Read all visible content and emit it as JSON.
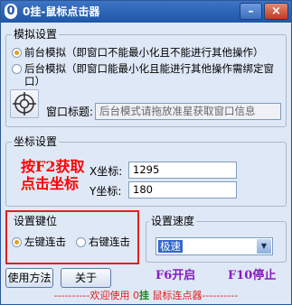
{
  "window": {
    "logo_glyph": "0",
    "title": "0挂-鼠标点击器",
    "minimize_glyph": "–",
    "close_glyph": "×"
  },
  "mode_group": {
    "label": "模拟设置",
    "options": [
      {
        "label": "前台模拟（即窗口不能最小化且不能进行其他操作）",
        "checked": true
      },
      {
        "label": "后台模拟（即窗口能最小化且能进行其他操作需绑定窗口）",
        "checked": false
      }
    ],
    "window_title_label": "窗口标题:",
    "window_title_placeholder": "后台模式请拖放准星获取窗口信息"
  },
  "coord_group": {
    "label": "坐标设置",
    "hint_line1": "按F2获取",
    "hint_line2": "点击坐标",
    "x_label": "X坐标:",
    "x_value": "1295",
    "y_label": "Y坐标:",
    "y_value": "180"
  },
  "key_group": {
    "label": "设置键位",
    "options": [
      {
        "label": "左键连击",
        "checked": true
      },
      {
        "label": "右键连击",
        "checked": false
      }
    ]
  },
  "speed_group": {
    "label": "设置速度",
    "selected": "极速"
  },
  "buttons": {
    "usage": "使用方法",
    "about": "关于"
  },
  "hotkeys": {
    "start": "F6开启",
    "stop": "F10停止"
  },
  "footer": {
    "prefix": "----------欢迎使用 0",
    "brand": "挂",
    "suffix": " 鼠标连点器----------"
  },
  "colors": {
    "titlebar": "#1f56a8",
    "hint": "#ff0000",
    "hotkey": "#8a1ac4",
    "highlight_box": "#e02020",
    "footer_brand": "#1a8a1a"
  }
}
